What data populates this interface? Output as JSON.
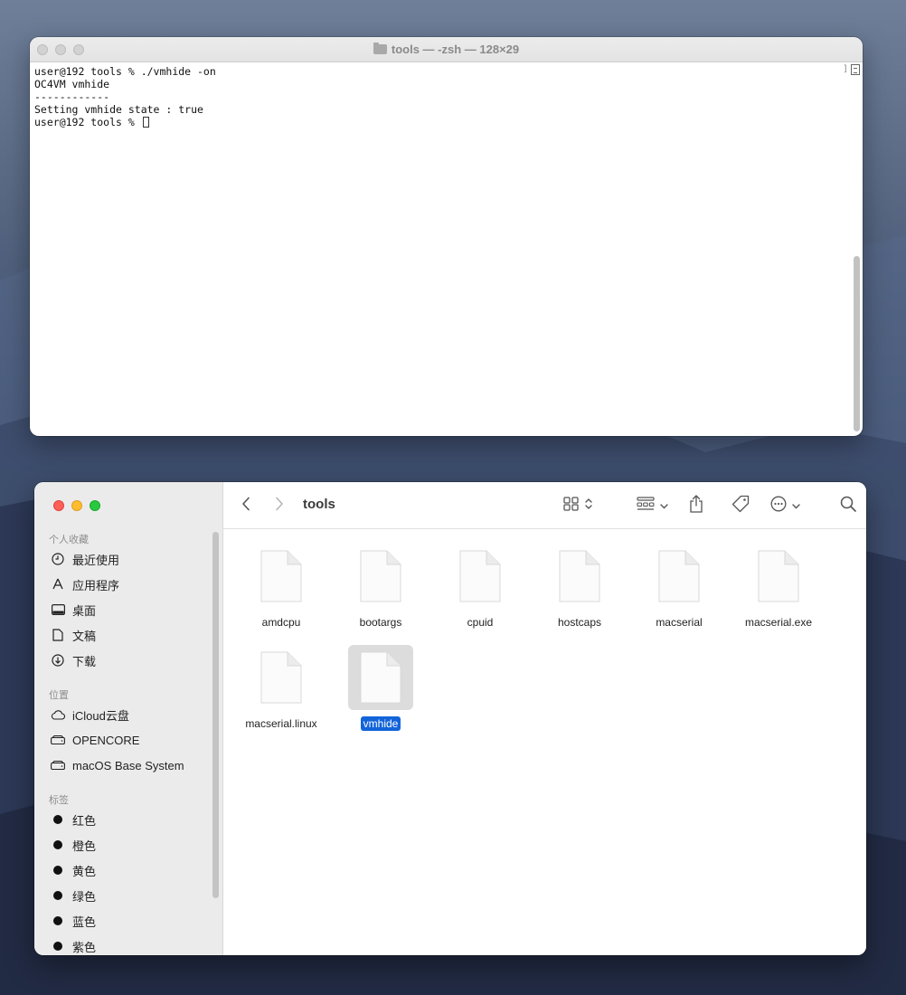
{
  "terminal": {
    "title": "tools — -zsh — 128×29",
    "lines": [
      "user@192 tools % ./vmhide -on",
      "OC4VM vmhide",
      "------------",
      "Setting vmhide state : true",
      "user@192 tools % "
    ]
  },
  "finder": {
    "title": "tools",
    "sidebar": {
      "favorites_header": "个人收藏",
      "favorites": [
        {
          "label": "最近使用",
          "icon": "clock-icon"
        },
        {
          "label": "应用程序",
          "icon": "apps-icon"
        },
        {
          "label": "桌面",
          "icon": "desktop-icon"
        },
        {
          "label": "文稿",
          "icon": "document-icon"
        },
        {
          "label": "下载",
          "icon": "download-icon"
        }
      ],
      "locations_header": "位置",
      "locations": [
        {
          "label": "iCloud云盘",
          "icon": "cloud-icon"
        },
        {
          "label": "OPENCORE",
          "icon": "drive-icon"
        },
        {
          "label": "macOS Base System",
          "icon": "drive-icon"
        }
      ],
      "tags_header": "标签",
      "tags": [
        {
          "label": "红色"
        },
        {
          "label": "橙色"
        },
        {
          "label": "黄色"
        },
        {
          "label": "绿色"
        },
        {
          "label": "蓝色"
        },
        {
          "label": "紫色"
        }
      ]
    },
    "files": [
      {
        "name": "amdcpu",
        "selected": false
      },
      {
        "name": "bootargs",
        "selected": false
      },
      {
        "name": "cpuid",
        "selected": false
      },
      {
        "name": "hostcaps",
        "selected": false
      },
      {
        "name": "macserial",
        "selected": false
      },
      {
        "name": "macserial.exe",
        "selected": false
      },
      {
        "name": "macserial.linux",
        "selected": false
      },
      {
        "name": "vmhide",
        "selected": true
      }
    ],
    "selection_color": "#1364d9"
  }
}
